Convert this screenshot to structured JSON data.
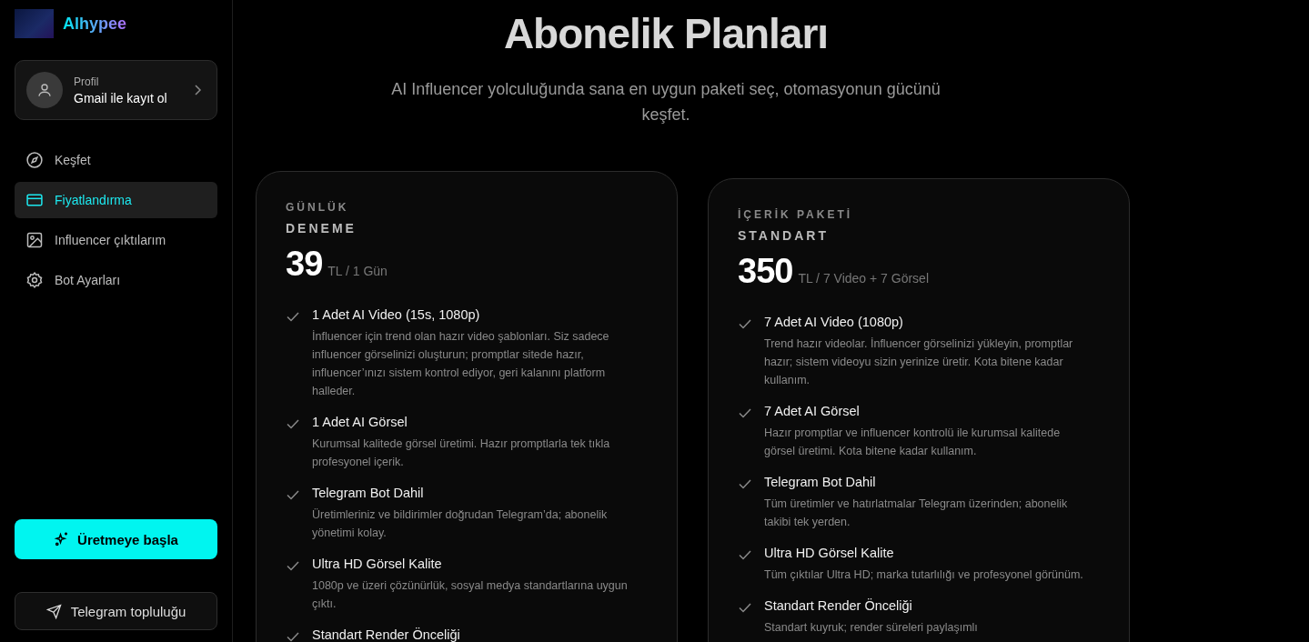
{
  "sidebar": {
    "brand": "Alhypee",
    "profile": {
      "label": "Profil",
      "action": "Gmail ile kayıt ol"
    },
    "nav": [
      {
        "label": "Keşfet",
        "selected": false
      },
      {
        "label": "Fiyatlandırma",
        "selected": true
      },
      {
        "label": "Influencer çıktılarım",
        "selected": false
      },
      {
        "label": "Bot Ayarları",
        "selected": false
      }
    ],
    "primary_button": "Üretmeye başla",
    "secondary_button": "Telegram topluluğu"
  },
  "page": {
    "title": "Abonelik Planları",
    "subtitle": "AI Influencer yolculuğunda sana en uygun paketi seç, otomasyonun gücünü keşfet."
  },
  "plans": [
    {
      "category": "GÜNLÜK",
      "name": "DENEME",
      "price": "39",
      "unit": "TL / 1 Gün",
      "features": [
        {
          "title": "1 Adet AI Video (15s, 1080p)",
          "description": "İnfluencer için trend olan hazır video şablonları. Siz sadece influencer görselinizi oluşturun; promptlar sitede hazır, influencer’ınızı sistem kontrol ediyor, geri kalanını platform halleder."
        },
        {
          "title": "1 Adet AI Görsel",
          "description": "Kurumsal kalitede görsel üretimi. Hazır promptlarla tek tıkla profesyonel içerik."
        },
        {
          "title": "Telegram Bot Dahil",
          "description": "Üretimleriniz ve bildirimler doğrudan Telegram’da; abonelik yönetimi kolay."
        },
        {
          "title": "Ultra HD Görsel Kalite",
          "description": "1080p ve üzeri çözünürlük, sosyal medya standartlarına uygun çıktı."
        },
        {
          "title": "Standart Render Önceliği"
        }
      ]
    },
    {
      "category": "İÇERİK PAKETİ",
      "name": "STANDART",
      "price": "350",
      "unit": "TL / 7 Video + 7 Görsel",
      "features": [
        {
          "title": "7 Adet AI Video (1080p)",
          "description": "Trend hazır videolar. İnfluencer görselinizi yükleyin, promptlar hazır; sistem videoyu sizin yerinize üretir. Kota bitene kadar kullanım."
        },
        {
          "title": "7 Adet AI Görsel",
          "description": "Hazır promptlar ve influencer kontrolü ile kurumsal kalitede görsel üretimi. Kota bitene kadar kullanım."
        },
        {
          "title": "Telegram Bot Dahil",
          "description": "Tüm üretimler ve hatırlatmalar Telegram üzerinden; abonelik takibi tek yerden."
        },
        {
          "title": "Ultra HD Görsel Kalite",
          "description": "Tüm çıktılar Ultra HD; marka tutarlılığı ve profesyonel görünüm."
        },
        {
          "title": "Standart Render Önceliği",
          "description": "Standart kuyruk; render süreleri paylaşımlı"
        }
      ]
    }
  ]
}
